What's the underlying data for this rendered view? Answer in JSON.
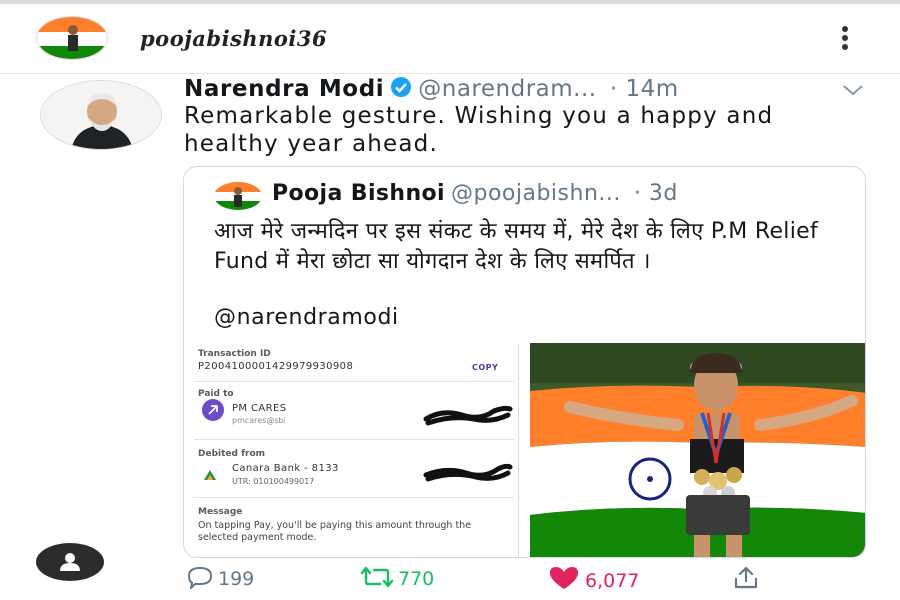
{
  "instagram": {
    "username": "poojabishnoi36"
  },
  "tweet": {
    "author_name": "Narendra Modi",
    "handle": "@narendram...",
    "time": "· 14m",
    "text": "Remarkable gesture. Wishing you a happy and healthy year ahead.",
    "verified": true
  },
  "quoted": {
    "author_name": "Pooja Bishnoi",
    "handle": "@poojabishn...",
    "time": "· 3d",
    "text": "आज मेरे जन्मदिन पर इस संकट के समय में, मेरे देश के लिए P.M Relief Fund में मेरा छोटा सा योगदान देश के लिए समर्पित ।",
    "mention": "@narendramodi"
  },
  "payment": {
    "transaction_label": "Transaction ID",
    "transaction_id": "P2004100001429979930908",
    "copy_label": "COPY",
    "paid_to_label": "Paid to",
    "payee_name": "PM CARES",
    "payee_upi": "pmcares@sbi",
    "debited_label": "Debited from",
    "bank": "Canara Bank - 8133",
    "utr": "UTR: 010100499017",
    "message_label": "Message",
    "message_text": "On tapping Pay, you'll be paying this amount through the selected payment mode."
  },
  "actions": {
    "replies": "199",
    "retweets": "770",
    "likes": "6,077"
  },
  "colors": {
    "twitter_blue": "#1da1f2",
    "retweet_green": "#17bf63",
    "like_red": "#e0245e",
    "upi_purple": "#6b4bc9",
    "flag_saffron": "#ff7f2a",
    "flag_green": "#138808"
  },
  "icons": [
    "more-vertical-icon",
    "verified-badge-icon",
    "chevron-down-icon",
    "reply-icon",
    "retweet-icon",
    "heart-icon",
    "share-icon",
    "user-icon",
    "arrow-up-right-icon"
  ]
}
